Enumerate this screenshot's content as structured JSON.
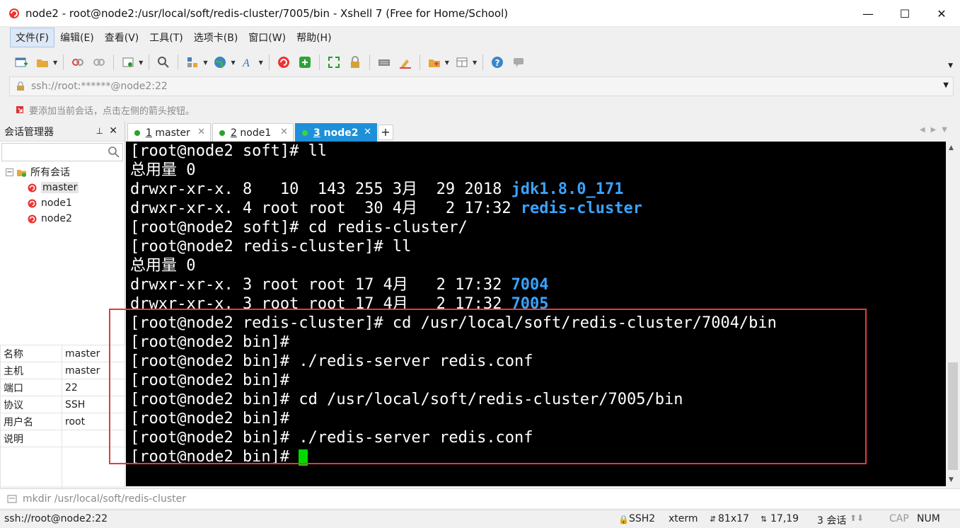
{
  "window": {
    "title": "node2 - root@node2:/usr/local/soft/redis-cluster/7005/bin - Xshell 7 (Free for Home/School)",
    "minimize": "—",
    "maximize": "☐",
    "close": "✕"
  },
  "menu": [
    "文件(F)",
    "编辑(E)",
    "查看(V)",
    "工具(T)",
    "选项卡(B)",
    "窗口(W)",
    "帮助(H)"
  ],
  "address_bar": {
    "value": "ssh://root:******@node2:22"
  },
  "hint_bar": {
    "text": "要添加当前会话，点击左侧的箭头按钮。"
  },
  "session_manager": {
    "title": "会话管理器",
    "pin": "📌",
    "close": "✕",
    "root": "所有会话",
    "sessions": [
      "master",
      "node1",
      "node2"
    ],
    "selected": "master"
  },
  "properties": [
    {
      "key": "名称",
      "value": "master"
    },
    {
      "key": "主机",
      "value": "master"
    },
    {
      "key": "端口",
      "value": "22"
    },
    {
      "key": "协议",
      "value": "SSH"
    },
    {
      "key": "用户名",
      "value": "root"
    },
    {
      "key": "说明",
      "value": ""
    }
  ],
  "tabs": [
    {
      "num": "1",
      "label": "master",
      "active": false
    },
    {
      "num": "2",
      "label": "node1",
      "active": false
    },
    {
      "num": "3",
      "label": "node2",
      "active": true
    }
  ],
  "terminal": {
    "lines": [
      {
        "text": "[root@node2 soft]# ll",
        "dir": ""
      },
      {
        "text": "总用量 0",
        "dir": ""
      },
      {
        "text": "drwxr-xr-x. 8   10  143 255 3月  29 2018 ",
        "dir": "jdk1.8.0_171"
      },
      {
        "text": "drwxr-xr-x. 4 root root  30 4月   2 17:32 ",
        "dir": "redis-cluster"
      },
      {
        "text": "[root@node2 soft]# cd redis-cluster/",
        "dir": ""
      },
      {
        "text": "[root@node2 redis-cluster]# ll",
        "dir": ""
      },
      {
        "text": "总用量 0",
        "dir": ""
      },
      {
        "text": "drwxr-xr-x. 3 root root 17 4月   2 17:32 ",
        "dir": "7004"
      },
      {
        "text": "drwxr-xr-x. 3 root root 17 4月   2 17:32 ",
        "dir": "7005"
      },
      {
        "text": "[root@node2 redis-cluster]# cd /usr/local/soft/redis-cluster/7004/bin",
        "dir": ""
      },
      {
        "text": "[root@node2 bin]#",
        "dir": ""
      },
      {
        "text": "[root@node2 bin]# ./redis-server redis.conf",
        "dir": ""
      },
      {
        "text": "[root@node2 bin]#",
        "dir": ""
      },
      {
        "text": "[root@node2 bin]# cd /usr/local/soft/redis-cluster/7005/bin",
        "dir": ""
      },
      {
        "text": "[root@node2 bin]#",
        "dir": ""
      },
      {
        "text": "[root@node2 bin]# ./redis-server redis.conf",
        "dir": ""
      },
      {
        "text": "[root@node2 bin]# ",
        "dir": ""
      }
    ]
  },
  "command_bar": {
    "value": "mkdir /usr/local/soft/redis-cluster"
  },
  "status": {
    "connection": "ssh://root@node2:22",
    "protocol": "SSH2",
    "term": "xterm",
    "size": "81x17",
    "pos": "17,19",
    "sessions": "3 会话",
    "cap": "CAP",
    "num": "NUM"
  },
  "colors": {
    "tab_active": "#1e90d8",
    "terminal_bg": "#000000",
    "terminal_dir": "#3aa3ff",
    "cursor": "#00d800",
    "highlight_box": "#e03c3c"
  }
}
